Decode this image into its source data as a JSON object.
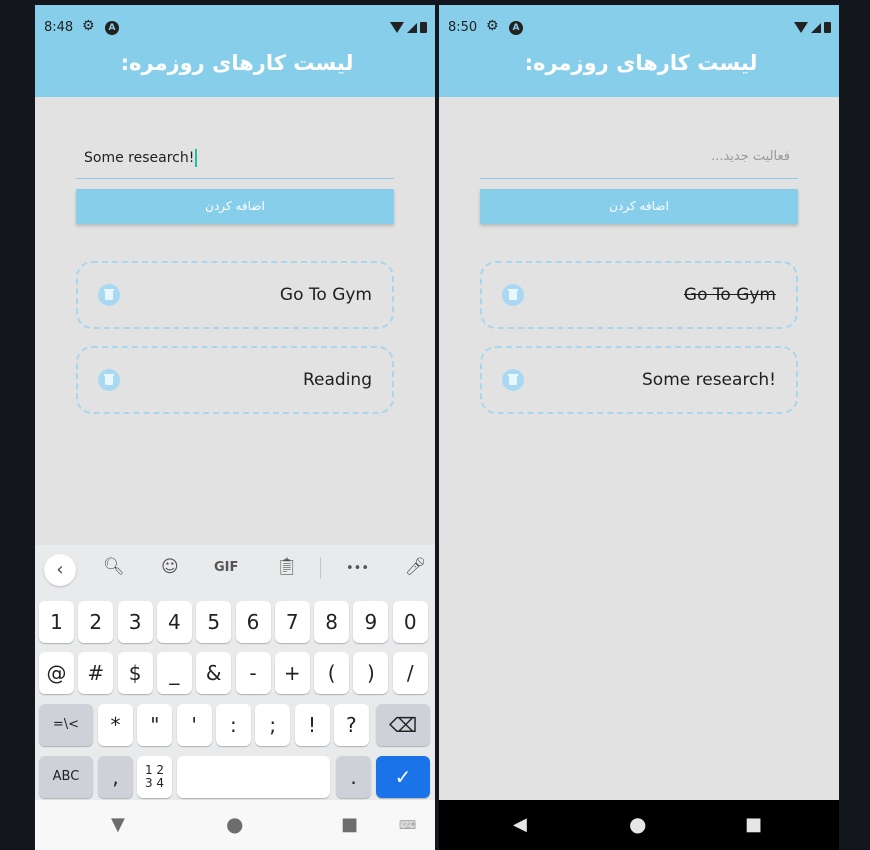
{
  "left": {
    "status": {
      "time": "8:48"
    },
    "app_title": "لیست کارهای روزمره:",
    "input": {
      "value": "Some research!"
    },
    "add_button": "اضافه کردن",
    "tasks": [
      {
        "text": "Go To Gym",
        "done": false
      },
      {
        "text": "Reading",
        "done": false
      }
    ],
    "keyboard": {
      "toolbar": [
        "back-icon",
        "search-icon",
        "sticker-icon",
        "GIF",
        "clipboard-icon",
        "more-icon",
        "mic-icon"
      ],
      "gif_label": "GIF",
      "more_label": "•••",
      "rows": [
        [
          "1",
          "2",
          "3",
          "4",
          "5",
          "6",
          "7",
          "8",
          "9",
          "0"
        ],
        [
          "@",
          "#",
          "$",
          "_",
          "&",
          "-",
          "+",
          "(",
          ")",
          "/"
        ],
        [
          "=\\<",
          "*",
          "\"",
          "'",
          ":",
          ";",
          "!",
          "?",
          "⌫"
        ],
        [
          "ABC",
          ",",
          "12\n34",
          "",
          ".",
          "✓"
        ]
      ],
      "abc_label": "ABC",
      "sym_label": "=\\<",
      "num_top": "1 2",
      "num_bottom": "3 4",
      "comma": ",",
      "period": "."
    }
  },
  "right": {
    "status": {
      "time": "8:50"
    },
    "app_title": "لیست کارهای روزمره:",
    "input": {
      "placeholder": "فعالیت جدید..."
    },
    "add_button": "اضافه کردن",
    "tasks": [
      {
        "text": "Go To Gym",
        "done": true
      },
      {
        "text": "Some research!",
        "done": false
      }
    ]
  },
  "colors": {
    "accent": "#87ceeb",
    "background": "#e2e2e2",
    "task_border": "#a8d6ee",
    "keyboard_enter": "#1a73e8"
  }
}
